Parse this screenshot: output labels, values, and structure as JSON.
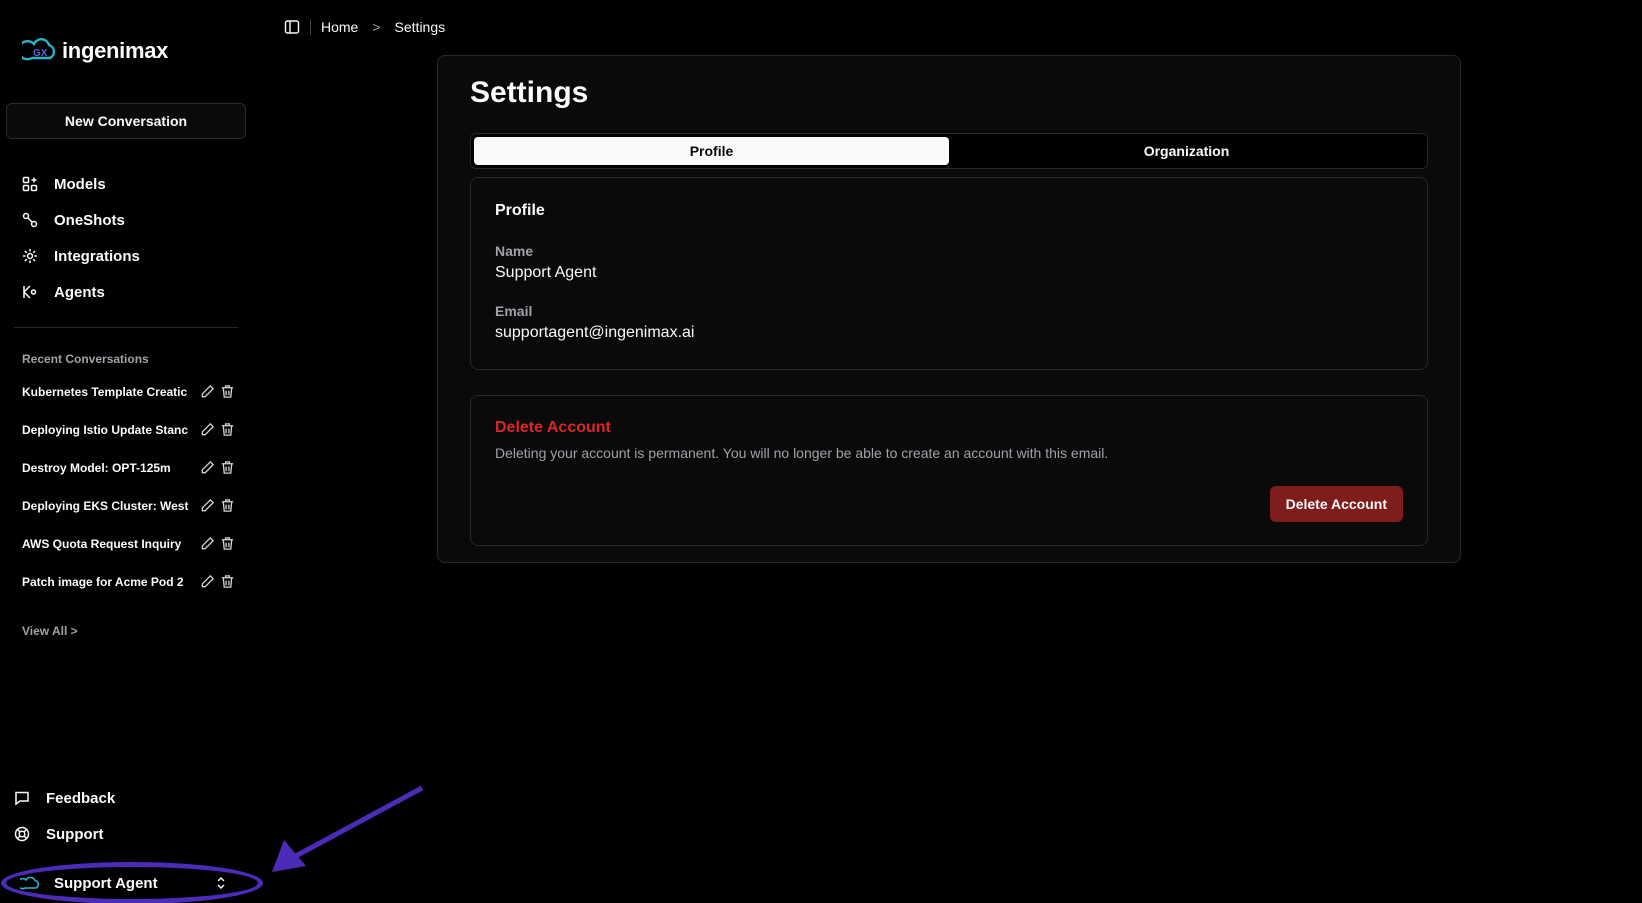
{
  "sidebar": {
    "logo_text": "ingenimax",
    "new_conversation": "New Conversation",
    "nav": [
      {
        "label": "Models",
        "icon": "models-icon"
      },
      {
        "label": "OneShots",
        "icon": "oneshots-icon"
      },
      {
        "label": "Integrations",
        "icon": "integrations-icon"
      },
      {
        "label": "Agents",
        "icon": "agents-icon"
      }
    ],
    "recent_title": "Recent Conversations",
    "recent": [
      {
        "label": "Kubernetes Template Creatic"
      },
      {
        "label": "Deploying Istio Update Stanc"
      },
      {
        "label": "Destroy Model: OPT-125m"
      },
      {
        "label": "Deploying EKS Cluster: West"
      },
      {
        "label": "AWS Quota Request Inquiry"
      },
      {
        "label": "Patch image for Acme Pod 2"
      }
    ],
    "view_all": "View All >",
    "bottom_nav": [
      {
        "label": "Feedback",
        "icon": "message-square-icon"
      },
      {
        "label": "Support",
        "icon": "life-buoy-icon"
      }
    ],
    "user_name": "Support Agent"
  },
  "breadcrumb": {
    "home": "Home",
    "separator": ">",
    "current": "Settings"
  },
  "main": {
    "title": "Settings",
    "tabs": [
      {
        "label": "Profile",
        "active": true
      },
      {
        "label": "Organization",
        "active": false
      }
    ],
    "profile": {
      "title": "Profile",
      "name_label": "Name",
      "name_value": "Support Agent",
      "email_label": "Email",
      "email_value": "supportagent@ingenimax.ai"
    },
    "danger": {
      "title": "Delete Account",
      "description": "Deleting your account is permanent. You will no longer be able to create an account with this email.",
      "button": "Delete Account"
    }
  },
  "colors": {
    "background": "#000000",
    "danger": "#dc2626",
    "danger_button": "#7f1d1d",
    "annotation": "#4b2bb8",
    "logo_accent": "#2ab3c9"
  }
}
